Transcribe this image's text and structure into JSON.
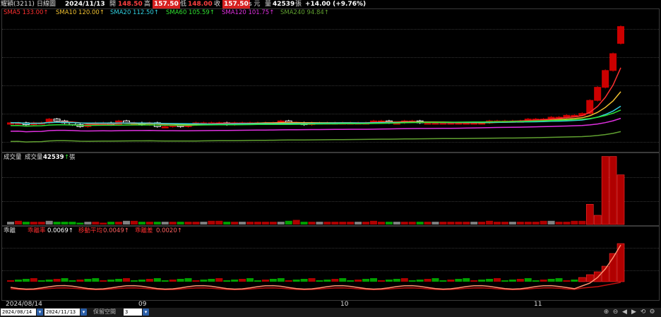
{
  "header": {
    "symbol": "耀穎(3211)",
    "period": "日線圖",
    "date": "2024/11/13",
    "open_label": "開",
    "open": "148.50",
    "high_label": "高",
    "high": "157.50",
    "low_label": "低",
    "low": "148.00",
    "close_label": "收",
    "close": "157.50",
    "close_suffix": "s 元",
    "volume_label": "量",
    "volume": "42539",
    "volume_unit": "張",
    "change": "+14.00 (+9.76%)"
  },
  "ma_legend": [
    {
      "label": "SMA5 133.00↑",
      "color": "#ff3030"
    },
    {
      "label": "SMA10 120.00↑",
      "color": "#f0c030"
    },
    {
      "label": "SMA20 112.50↑",
      "color": "#30d0e0"
    },
    {
      "label": "SMA60 105.59↑",
      "color": "#30e030"
    },
    {
      "label": "SMA120 101.75↑",
      "color": "#e030e0"
    },
    {
      "label": "SMA240 94.84↑",
      "color": "#60a030"
    }
  ],
  "volume_panel": {
    "title": "成交量",
    "label": "成交量",
    "value": "42539",
    "arrow": "↑",
    "unit": "張"
  },
  "indicator_panel": {
    "title": "乖離",
    "items": [
      {
        "name": "乖離率",
        "value": "0.0069↑"
      },
      {
        "name": "移動平均",
        "value": "0.0049↑"
      },
      {
        "name": "乖離差",
        "value": "0.0020↑"
      }
    ]
  },
  "x_axis": {
    "start": "2024/08/14",
    "ticks": [
      "09",
      "10",
      "11"
    ]
  },
  "bottom": {
    "start_date": "2024/08/14",
    "end_date": "2024/11/13",
    "reserve_label": "保留空間",
    "reserve_value": "3"
  },
  "colors": {
    "up": "#cc0000",
    "down": "#ffffff",
    "vol_up": "#b00000",
    "vol_down": "#00a000",
    "vol_flat": "#808080"
  },
  "chart_data": {
    "type": "candlestick",
    "dates_range": [
      "2024/08/14",
      "2024/11/13"
    ],
    "last_candle": {
      "open": 148.5,
      "high": 157.5,
      "low": 148.0,
      "close": 157.5
    },
    "close_series": [
      106,
      106,
      105,
      106,
      106,
      108,
      107,
      106,
      105,
      104,
      105,
      106,
      106,
      105,
      107,
      106,
      106,
      105,
      106,
      104,
      104,
      105,
      104,
      105,
      106,
      106,
      106,
      106,
      105,
      106,
      106,
      106,
      106,
      106,
      106,
      107,
      106,
      106,
      105,
      106,
      106,
      106,
      106,
      106,
      106,
      106,
      106,
      107,
      107,
      106,
      106,
      107,
      107,
      106,
      106,
      106,
      106,
      106,
      106,
      106,
      106,
      106,
      107,
      107,
      107,
      107,
      107,
      108,
      108,
      108,
      109,
      109,
      110,
      110,
      111,
      118,
      125,
      134,
      143,
      157.5
    ],
    "volume_series": [
      3,
      4,
      3,
      3,
      3,
      4,
      3,
      3,
      3,
      2,
      3,
      3,
      2,
      3,
      3,
      4,
      4,
      3,
      3,
      3,
      3,
      3,
      3,
      3,
      3,
      3,
      4,
      4,
      3,
      3,
      3,
      3,
      3,
      3,
      3,
      3,
      4,
      5,
      3,
      3,
      3,
      3,
      3,
      3,
      3,
      3,
      3,
      4,
      3,
      3,
      3,
      3,
      3,
      3,
      3,
      3,
      3,
      3,
      3,
      3,
      3,
      3,
      4,
      3,
      3,
      3,
      3,
      3,
      3,
      4,
      4,
      3,
      3,
      4,
      4,
      22,
      10,
      74,
      74,
      54
    ],
    "moving_averages": [
      "SMA5",
      "SMA10",
      "SMA20",
      "SMA60",
      "SMA120",
      "SMA240"
    ]
  }
}
